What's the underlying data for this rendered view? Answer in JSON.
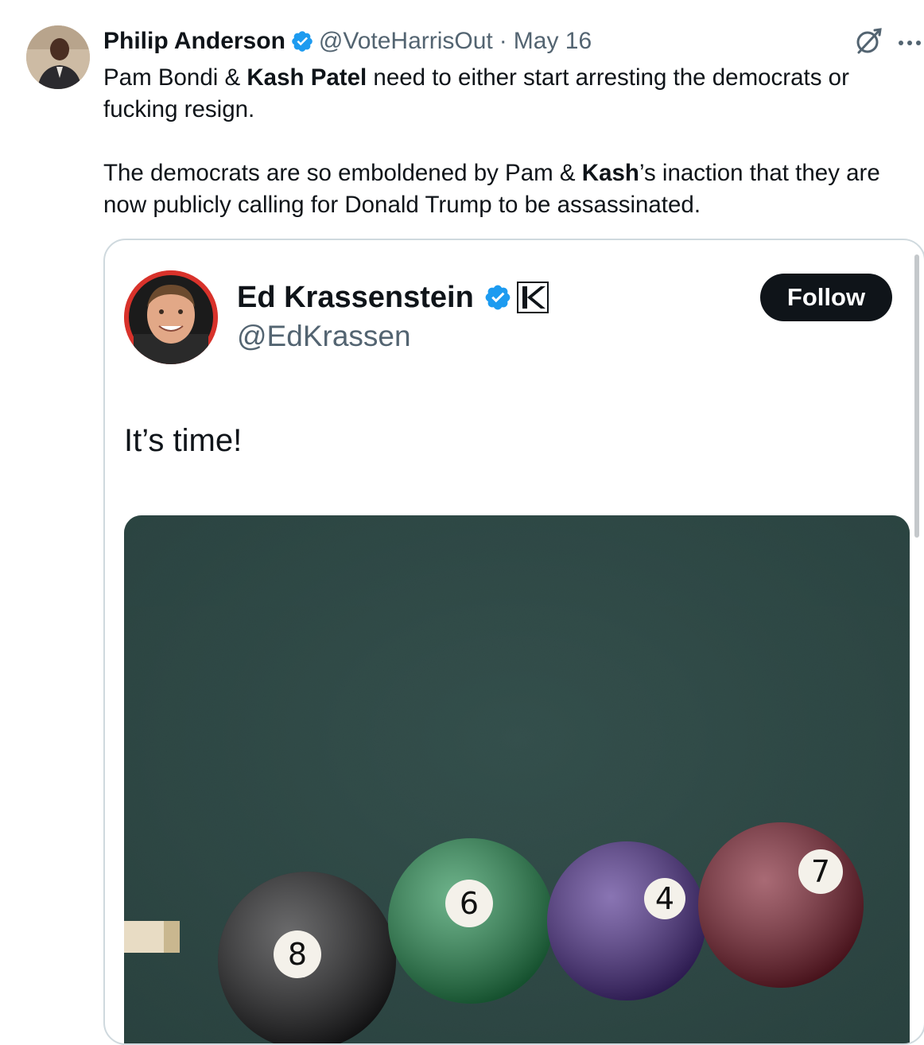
{
  "tweet": {
    "author_name": "Philip Anderson",
    "author_handle": "@VoteHarrisOut",
    "separator": "·",
    "date": "May 16",
    "verified_color": "#1d9bf0",
    "text": {
      "p1_a": "Pam Bondi & ",
      "p1_b": "Kash Patel",
      "p1_c": " need to either start arresting the democrats or fucking resign.",
      "p2_a": "The democrats are so emboldened by Pam & ",
      "p2_b": "Kash",
      "p2_c": "’s inaction that they are now publicly calling for Donald Trump to be assassinated."
    },
    "icons": {
      "grok": "grok-icon",
      "more": "more-icon",
      "verified": "verified-badge-icon",
      "avatar": "avatar"
    }
  },
  "quote": {
    "author_name": "Ed Krassenstein",
    "author_handle": "@EdKrassen",
    "follow_label": "Follow",
    "text": "It’s time!",
    "affiliate_badge": "k-affiliate-icon",
    "media": {
      "description_icon": "pool-balls-image",
      "ball_numbers": [
        "8",
        "6",
        "4",
        "7"
      ],
      "ball_colors": [
        "#1a1a1c",
        "#1f8a4c",
        "#4a2a8a",
        "#7a1a2a"
      ],
      "felt_color": "#2f4a47"
    }
  }
}
